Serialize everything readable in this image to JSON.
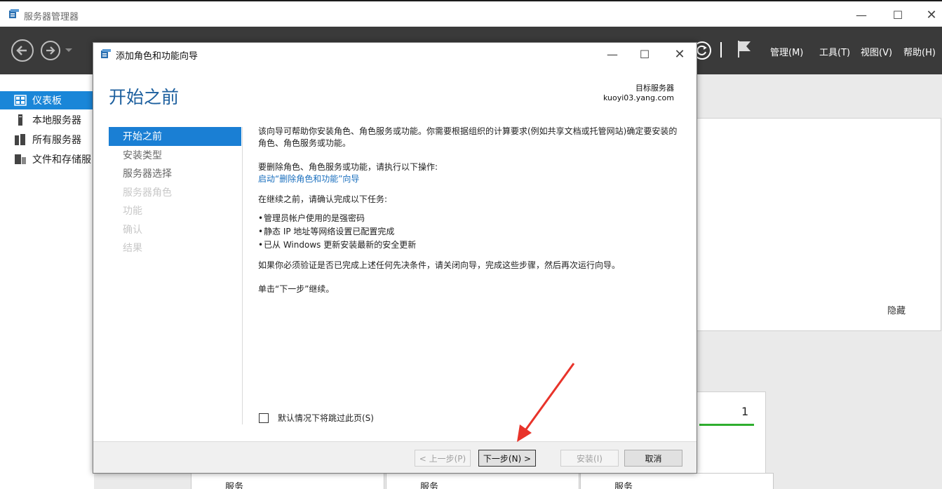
{
  "outer": {
    "title": "服务器管理器",
    "menu": [
      "管理(M)",
      "工具(T)",
      "视图(V)",
      "帮助(H)"
    ],
    "sidebar": [
      {
        "label": "仪表板",
        "icon": "dashboard-icon",
        "active": true
      },
      {
        "label": "本地服务器",
        "icon": "server-icon",
        "active": false
      },
      {
        "label": "所有服务器",
        "icon": "servers-icon",
        "active": false
      },
      {
        "label": "文件和存储服",
        "icon": "storage-icon",
        "active": false
      }
    ],
    "panel_hide": "隐藏",
    "card_count": "1",
    "bottom_columns": [
      "服务",
      "服务",
      "服务"
    ]
  },
  "wizard": {
    "title": "添加角色和功能向导",
    "heading": "开始之前",
    "target_label": "目标服务器",
    "target_server": "kuoyi03.yang.com",
    "steps": [
      {
        "label": "开始之前",
        "state": "active"
      },
      {
        "label": "安装类型",
        "state": "enabled"
      },
      {
        "label": "服务器选择",
        "state": "enabled"
      },
      {
        "label": "服务器角色",
        "state": "disabled"
      },
      {
        "label": "功能",
        "state": "disabled"
      },
      {
        "label": "确认",
        "state": "disabled"
      },
      {
        "label": "结果",
        "state": "disabled"
      }
    ],
    "body": {
      "intro": "该向导可帮助你安装角色、角色服务或功能。你需要根据组织的计算要求(例如共享文档或托管网站)确定要安装的角色、角色服务或功能。",
      "remove_heading": "要删除角色、角色服务或功能，请执行以下操作:",
      "remove_link": "启动“删除角色和功能”向导",
      "before_heading": "在继续之前，请确认完成以下任务:",
      "bullets": [
        "管理员帐户使用的是强密码",
        "静态 IP 地址等网络设置已配置完成",
        "已从 Windows 更新安装最新的安全更新"
      ],
      "verify": "如果你必须验证是否已完成上述任何先决条件，请关闭向导，完成这些步骤，然后再次运行向导。",
      "continue": "单击“下一步”继续。"
    },
    "skip_checkbox": {
      "label": "默认情况下将跳过此页(S)",
      "checked": false
    },
    "buttons": {
      "previous": "< 上一步(P)",
      "next": "下一步(N) >",
      "install": "安装(I)",
      "cancel": "取消"
    },
    "annotation_color": "#e8332a"
  }
}
